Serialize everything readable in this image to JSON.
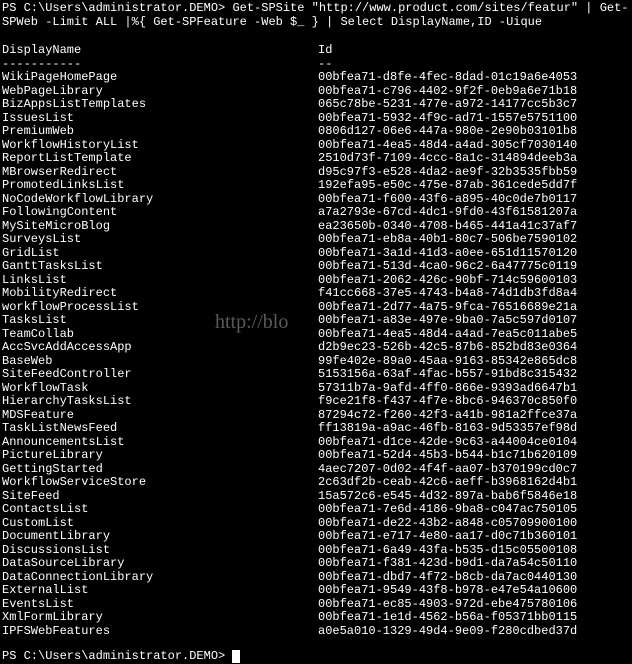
{
  "prompt_prefix": "PS C:\\Users\\administrator.DEMO> ",
  "command": "Get-SPSite \"http://www.product.com/sites/featur\" | Get-SPWeb -Limit ALL |%{ Get-SPFeature -Web $_ } | Select DisplayName,ID -Uique",
  "headers": {
    "name": "DisplayName",
    "id": "Id"
  },
  "underlines": {
    "name": "-----------",
    "id": "--"
  },
  "rows": [
    {
      "name": "WikiPageHomePage",
      "id": "00bfea71-d8fe-4fec-8dad-01c19a6e4053"
    },
    {
      "name": "WebPageLibrary",
      "id": "00bfea71-c796-4402-9f2f-0eb9a6e71b18"
    },
    {
      "name": "BizAppsListTemplates",
      "id": "065c78be-5231-477e-a972-14177cc5b3c7"
    },
    {
      "name": "IssuesList",
      "id": "00bfea71-5932-4f9c-ad71-1557e5751100"
    },
    {
      "name": "PremiumWeb",
      "id": "0806d127-06e6-447a-980e-2e90b03101b8"
    },
    {
      "name": "WorkflowHistoryList",
      "id": "00bfea71-4ea5-48d4-a4ad-305cf7030140"
    },
    {
      "name": "ReportListTemplate",
      "id": "2510d73f-7109-4ccc-8a1c-314894deeb3a"
    },
    {
      "name": "MBrowserRedirect",
      "id": "d95c97f3-e528-4da2-ae9f-32b3535fbb59"
    },
    {
      "name": "PromotedLinksList",
      "id": "192efa95-e50c-475e-87ab-361cede5dd7f"
    },
    {
      "name": "NoCodeWorkflowLibrary",
      "id": "00bfea71-f600-43f6-a895-40c0de7b0117"
    },
    {
      "name": "FollowingContent",
      "id": "a7a2793e-67cd-4dc1-9fd0-43f61581207a"
    },
    {
      "name": "MySiteMicroBlog",
      "id": "ea23650b-0340-4708-b465-441a41c37af7"
    },
    {
      "name": "SurveysList",
      "id": "00bfea71-eb8a-40b1-80c7-506be7590102"
    },
    {
      "name": "GridList",
      "id": "00bfea71-3a1d-41d3-a0ee-651d11570120"
    },
    {
      "name": "GanttTasksList",
      "id": "00bfea71-513d-4ca0-96c2-6a47775c0119"
    },
    {
      "name": "LinksList",
      "id": "00bfea71-2062-426c-90bf-714c59600103"
    },
    {
      "name": "MobilityRedirect",
      "id": "f41cc668-37e5-4743-b4a8-74d1db3fd8a4"
    },
    {
      "name": "workflowProcessList",
      "id": "00bfea71-2d77-4a75-9fca-76516689e21a"
    },
    {
      "name": "TasksList",
      "id": "00bfea71-a83e-497e-9ba0-7a5c597d0107"
    },
    {
      "name": "TeamCollab",
      "id": "00bfea71-4ea5-48d4-a4ad-7ea5c011abe5"
    },
    {
      "name": "AccSvcAddAccessApp",
      "id": "d2b9ec23-526b-42c5-87b6-852bd83e0364"
    },
    {
      "name": "BaseWeb",
      "id": "99fe402e-89a0-45aa-9163-85342e865dc8"
    },
    {
      "name": "SiteFeedController",
      "id": "5153156a-63af-4fac-b557-91bd8c315432"
    },
    {
      "name": "WorkflowTask",
      "id": "57311b7a-9afd-4ff0-866e-9393ad6647b1"
    },
    {
      "name": "HierarchyTasksList",
      "id": "f9ce21f8-f437-4f7e-8bc6-946370c850f0"
    },
    {
      "name": "MDSFeature",
      "id": "87294c72-f260-42f3-a41b-981a2ffce37a"
    },
    {
      "name": "TaskListNewsFeed",
      "id": "ff13819a-a9ac-46fb-8163-9d53357ef98d"
    },
    {
      "name": "AnnouncementsList",
      "id": "00bfea71-d1ce-42de-9c63-a44004ce0104"
    },
    {
      "name": "PictureLibrary",
      "id": "00bfea71-52d4-45b3-b544-b1c71b620109"
    },
    {
      "name": "GettingStarted",
      "id": "4aec7207-0d02-4f4f-aa07-b370199cd0c7"
    },
    {
      "name": "WorkflowServiceStore",
      "id": "2c63df2b-ceab-42c6-aeff-b3968162d4b1"
    },
    {
      "name": "SiteFeed",
      "id": "15a572c6-e545-4d32-897a-bab6f5846e18"
    },
    {
      "name": "ContactsList",
      "id": "00bfea71-7e6d-4186-9ba8-c047ac750105"
    },
    {
      "name": "CustomList",
      "id": "00bfea71-de22-43b2-a848-c05709900100"
    },
    {
      "name": "DocumentLibrary",
      "id": "00bfea71-e717-4e80-aa17-d0c71b360101"
    },
    {
      "name": "DiscussionsList",
      "id": "00bfea71-6a49-43fa-b535-d15c05500108"
    },
    {
      "name": "DataSourceLibrary",
      "id": "00bfea71-f381-423d-b9d1-da7a54c50110"
    },
    {
      "name": "DataConnectionLibrary",
      "id": "00bfea71-dbd7-4f72-b8cb-da7ac0440130"
    },
    {
      "name": "ExternalList",
      "id": "00bfea71-9549-43f8-b978-e47e54a10600"
    },
    {
      "name": "EventsList",
      "id": "00bfea71-ec85-4903-972d-ebe475780106"
    },
    {
      "name": "XmlFormLibrary",
      "id": "00bfea71-1e1d-4562-b56a-f05371bb0115"
    },
    {
      "name": "IPFSWebFeatures",
      "id": "a0e5a010-1329-49d4-9e09-f280cdbed37d"
    }
  ],
  "bottom_prompt": "PS C:\\Users\\administrator.DEMO> ",
  "watermark": "http://blo"
}
